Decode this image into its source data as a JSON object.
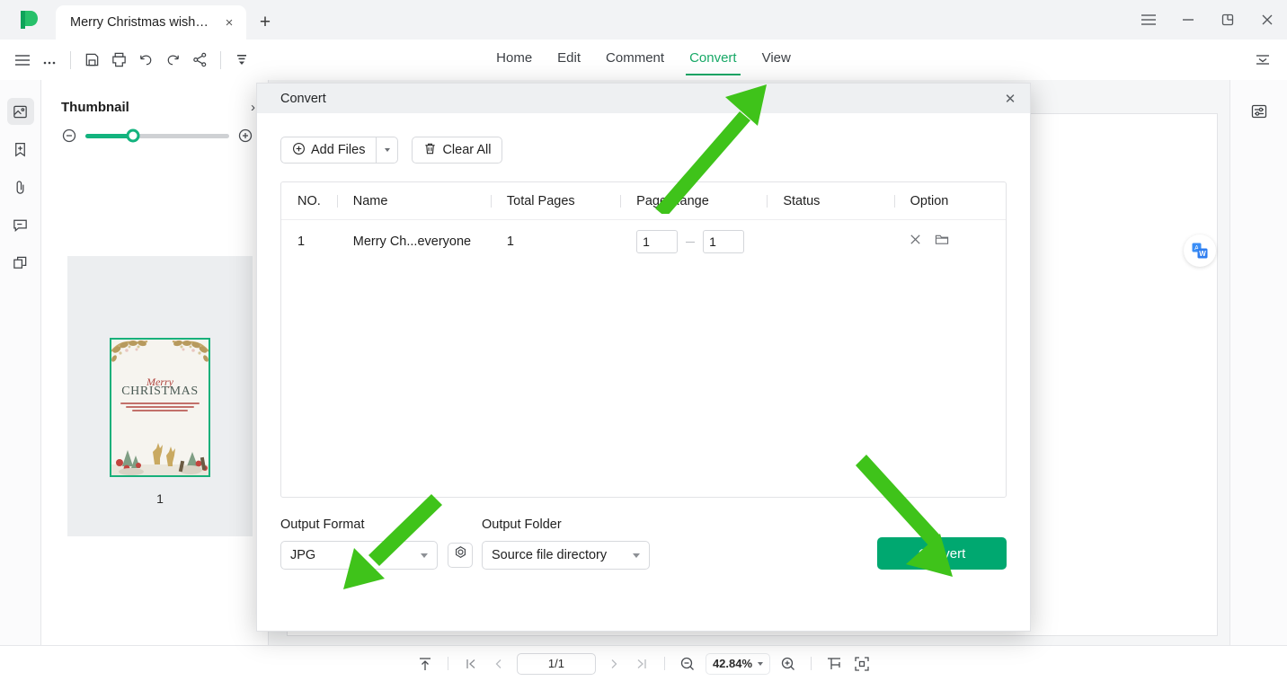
{
  "window": {
    "tab_title": "Merry Christmas wishes ...",
    "new_tab_label": "+",
    "close_label": "×",
    "controls": {
      "menu": "menu-icon",
      "minimize": "—",
      "restore": "restore-icon",
      "close": "✕"
    }
  },
  "toolbar": {
    "icons": [
      "hamburger-icon",
      "more-icon",
      "save-icon",
      "print-icon",
      "undo-icon",
      "redo-icon",
      "share-icon",
      "more-tools-icon"
    ],
    "overflow_label": "⋯",
    "collapse_ribbon": "collapse-ribbon-icon"
  },
  "menu": {
    "items": [
      {
        "label": "Home",
        "active": false
      },
      {
        "label": "Edit",
        "active": false
      },
      {
        "label": "Comment",
        "active": false
      },
      {
        "label": "Convert",
        "active": true
      },
      {
        "label": "View",
        "active": false
      }
    ]
  },
  "rail": {
    "items": [
      "thumbnail-panel-icon",
      "bookmark-icon",
      "attachment-icon",
      "comment-icon",
      "layers-icon"
    ]
  },
  "thumbnail_panel": {
    "title": "Thumbnail",
    "collapse_label": "›",
    "zoom_out_label": "zoom-out-icon",
    "zoom_in_label": "zoom-in-icon",
    "zoom_value": 33,
    "page_label": "1",
    "card": {
      "merry": "Merry",
      "christmas": "CHRISTMAS"
    }
  },
  "canvas": {
    "translate_badge": "translate-word-icon",
    "right_panel_icon": "properties-panel-icon"
  },
  "statusbar": {
    "fit_top_label": "scroll-top-icon",
    "first_label": "❘◀",
    "prev_label": "‹",
    "page_value": "1/1",
    "next_label": "›",
    "last_label": "▶❘",
    "zoom_out_label": "zoom-out-icon",
    "zoom_value": "42.84%",
    "zoom_in_label": "zoom-in-icon",
    "fit_width_label": "fit-width-icon",
    "fit_page_label": "fit-page-icon"
  },
  "dialog": {
    "title": "Convert",
    "close_label": "✕",
    "add_files_label": "Add Files",
    "add_files_caret": "▾",
    "clear_all_label": "Clear All",
    "columns": [
      "NO.",
      "Name",
      "Total Pages",
      "Page Range",
      "Status",
      "Option"
    ],
    "rows": [
      {
        "no": "1",
        "name": "Merry Ch...everyone",
        "total_pages": "1",
        "range_from": "1",
        "range_to": "1",
        "status": "",
        "remove_icon": "remove-icon",
        "folder_icon": "folder-icon"
      }
    ],
    "output_format_label": "Output Format",
    "output_format_value": "JPG",
    "settings_icon": "settings-gear-icon",
    "output_folder_label": "Output Folder",
    "output_folder_value": "Source file directory",
    "convert_label": "Convert"
  },
  "colors": {
    "brand_green": "#00a870",
    "accent_green": "#17a866",
    "annotation_green": "#3fc31a",
    "titlebar_bg": "#f2f3f5",
    "dialog_header_bg": "#eef0f2"
  }
}
